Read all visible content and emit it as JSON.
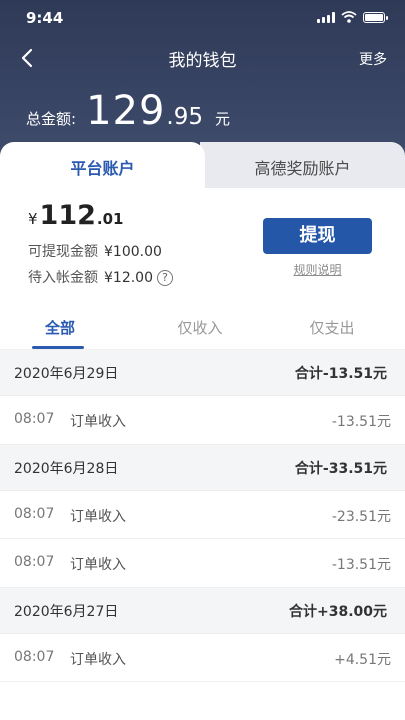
{
  "status": {
    "time": "9:44"
  },
  "nav": {
    "title": "我的钱包",
    "more": "更多"
  },
  "total": {
    "label": "总金额:",
    "integer": "129",
    "decimal": ".95",
    "unit": "元"
  },
  "tabs": [
    {
      "label": "平台账户"
    },
    {
      "label": "高德奖励账户"
    }
  ],
  "account": {
    "currency": "¥",
    "balance_integer": "112",
    "balance_decimal": ".01",
    "withdrawable_label": "可提现金额",
    "withdrawable_amount": "¥100.00",
    "pending_label": "待入帐金额",
    "pending_amount": "¥12.00",
    "help_glyph": "?",
    "withdraw_button": "提现",
    "rules_link": "规则说明"
  },
  "filters": [
    {
      "label": "全部"
    },
    {
      "label": "仅收入"
    },
    {
      "label": "仅支出"
    }
  ],
  "days": [
    {
      "date": "2020年6月29日",
      "total": "合计-13.51元",
      "entries": [
        {
          "time": "08:07",
          "title": "订单收入",
          "amount": "-13.51元"
        }
      ]
    },
    {
      "date": "2020年6月28日",
      "total": "合计-33.51元",
      "entries": [
        {
          "time": "08:07",
          "title": "订单收入",
          "amount": "-23.51元"
        },
        {
          "time": "08:07",
          "title": "订单收入",
          "amount": "-13.51元"
        }
      ]
    },
    {
      "date": "2020年6月27日",
      "total": "合计+38.00元",
      "entries": [
        {
          "time": "08:07",
          "title": "订单收入",
          "amount": "+4.51元"
        }
      ]
    }
  ],
  "colors": {
    "accent": "#2b5bb0",
    "button": "#2457a8",
    "header": "#3a4666"
  }
}
